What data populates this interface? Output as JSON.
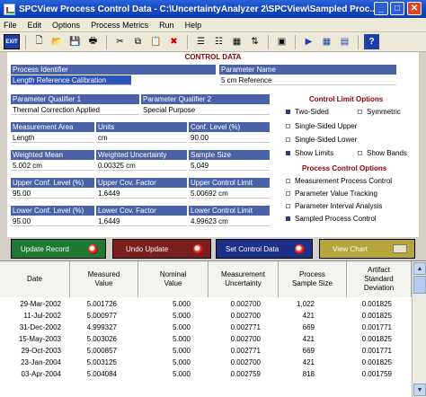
{
  "window": {
    "title": "SPCView Process Control Data - C:\\UncertaintyAnalyzer 2\\SPCView\\Sampled Proc..."
  },
  "menu": [
    "File",
    "Edit",
    "Options",
    "Process Metrics",
    "Run",
    "Help"
  ],
  "toolbar": {
    "exit_label": "EXIT"
  },
  "panel": {
    "title": "CONTROL DATA",
    "fields": {
      "process_identifier": {
        "label": "Process Identifier",
        "value": "Length Reference Calibration"
      },
      "parameter_name": {
        "label": "Parameter Name",
        "value": "5 cm Reference"
      },
      "qualifier1": {
        "label": "Parameter Qualifier 1",
        "value": "Thermal Correction Applied"
      },
      "qualifier2": {
        "label": "Parameter Qualifier 2",
        "value": "Special Purpose"
      },
      "measurement_area": {
        "label": "Measurement Area",
        "value": "Length"
      },
      "units": {
        "label": "Units",
        "value": "cm"
      },
      "conf_level": {
        "label": "Conf. Level (%)",
        "value": "90.00"
      },
      "weighted_mean": {
        "label": "Weighted Mean",
        "value": "5.002 cm"
      },
      "weighted_uncertainty": {
        "label": "Weighted Uncertainty",
        "value": "0.00325 cm"
      },
      "sample_size": {
        "label": "Sample Size",
        "value": "5,049"
      },
      "upper_conf": {
        "label": "Upper Conf. Level (%)",
        "value": "95.00"
      },
      "upper_cov": {
        "label": "Upper Cov. Factor",
        "value": "1.6449"
      },
      "upper_limit": {
        "label": "Upper Control Limit",
        "value": "5.00692 cm"
      },
      "lower_conf": {
        "label": "Lower Conf. Level (%)",
        "value": "95.00"
      },
      "lower_cov": {
        "label": "Lower Cov. Factor",
        "value": "1.6449"
      },
      "lower_limit": {
        "label": "Lower Control Limit",
        "value": "4.99623 cm"
      }
    },
    "control_limit_options": {
      "title": "Control Limit Options",
      "two_sided": "Two-Sided",
      "symmetric": "Symmetric",
      "single_upper": "Single-Sided Upper",
      "single_lower": "Single-Sided Lower",
      "show_limits": "Show Limits",
      "show_bands": "Show Bands"
    },
    "process_control_options": {
      "title": "Process Control Options",
      "items": [
        "Measurement Process Control",
        "Parameter Value Tracking",
        "Parameter Interval Analysis",
        "Sampled Process Control"
      ]
    }
  },
  "actions": {
    "update_record": "Update Record",
    "undo_update": "Undo Update",
    "set_control_data": "Set Control Data",
    "view_chart": "View Chart"
  },
  "actions_colors": {
    "update": "#1e7a32",
    "undo": "#7a1e1e",
    "set": "#1a2f8a",
    "view": "#b5a53a"
  },
  "table": {
    "headers": [
      "Date",
      "Measured\nValue",
      "Nominal\nValue",
      "Measurement\nUncertainty",
      "Process\nSample Size",
      "Artifact\nStandard\nDeviation"
    ],
    "rows": [
      [
        "29-Mar-2002",
        "5.001726",
        "5.000",
        "0.002700",
        "1,022",
        "0.001825"
      ],
      [
        "11-Jul-2002",
        "5.000977",
        "5.000",
        "0.002700",
        "421",
        "0.001825"
      ],
      [
        "31-Dec-2002",
        "4.999327",
        "5.000",
        "0.002771",
        "669",
        "0.001771"
      ],
      [
        "15-May-2003",
        "5.003026",
        "5.000",
        "0.002700",
        "421",
        "0.001825"
      ],
      [
        "29-Oct-2003",
        "5.000857",
        "5.000",
        "0.002771",
        "669",
        "0.001771"
      ],
      [
        "23-Jan-2004",
        "5.003125",
        "5.000",
        "0.002700",
        "421",
        "0.001825"
      ],
      [
        "03-Apr-2004",
        "5.004084",
        "5.000",
        "0.002759",
        "818",
        "0.001759"
      ]
    ]
  }
}
